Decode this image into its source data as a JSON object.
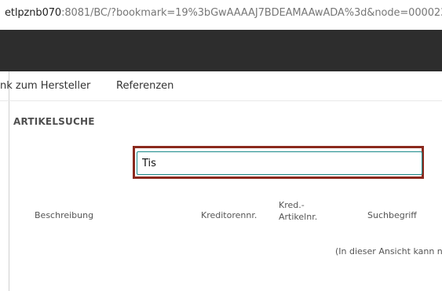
{
  "browser": {
    "url_host": "etlpznb070",
    "url_rest": ":8081/BC/?bookmark=19%3bGwAAAAJ7BDEAMAAwADA%3d&node=000023"
  },
  "actions": {
    "link_manufacturer": "nk zum Hersteller",
    "references": "Referenzen"
  },
  "section": {
    "title": "ARTIKELSUCHE"
  },
  "search": {
    "value": "Tis"
  },
  "columns": [
    {
      "line1": "Beschreibung",
      "line2": ""
    },
    {
      "line1": "Kreditorennr.",
      "line2": ""
    },
    {
      "line1": "Kred.-",
      "line2": "Artikelnr."
    },
    {
      "line1": "Suchbegriff",
      "line2": ""
    }
  ],
  "empty_message": "(In dieser Ansicht kann n"
}
